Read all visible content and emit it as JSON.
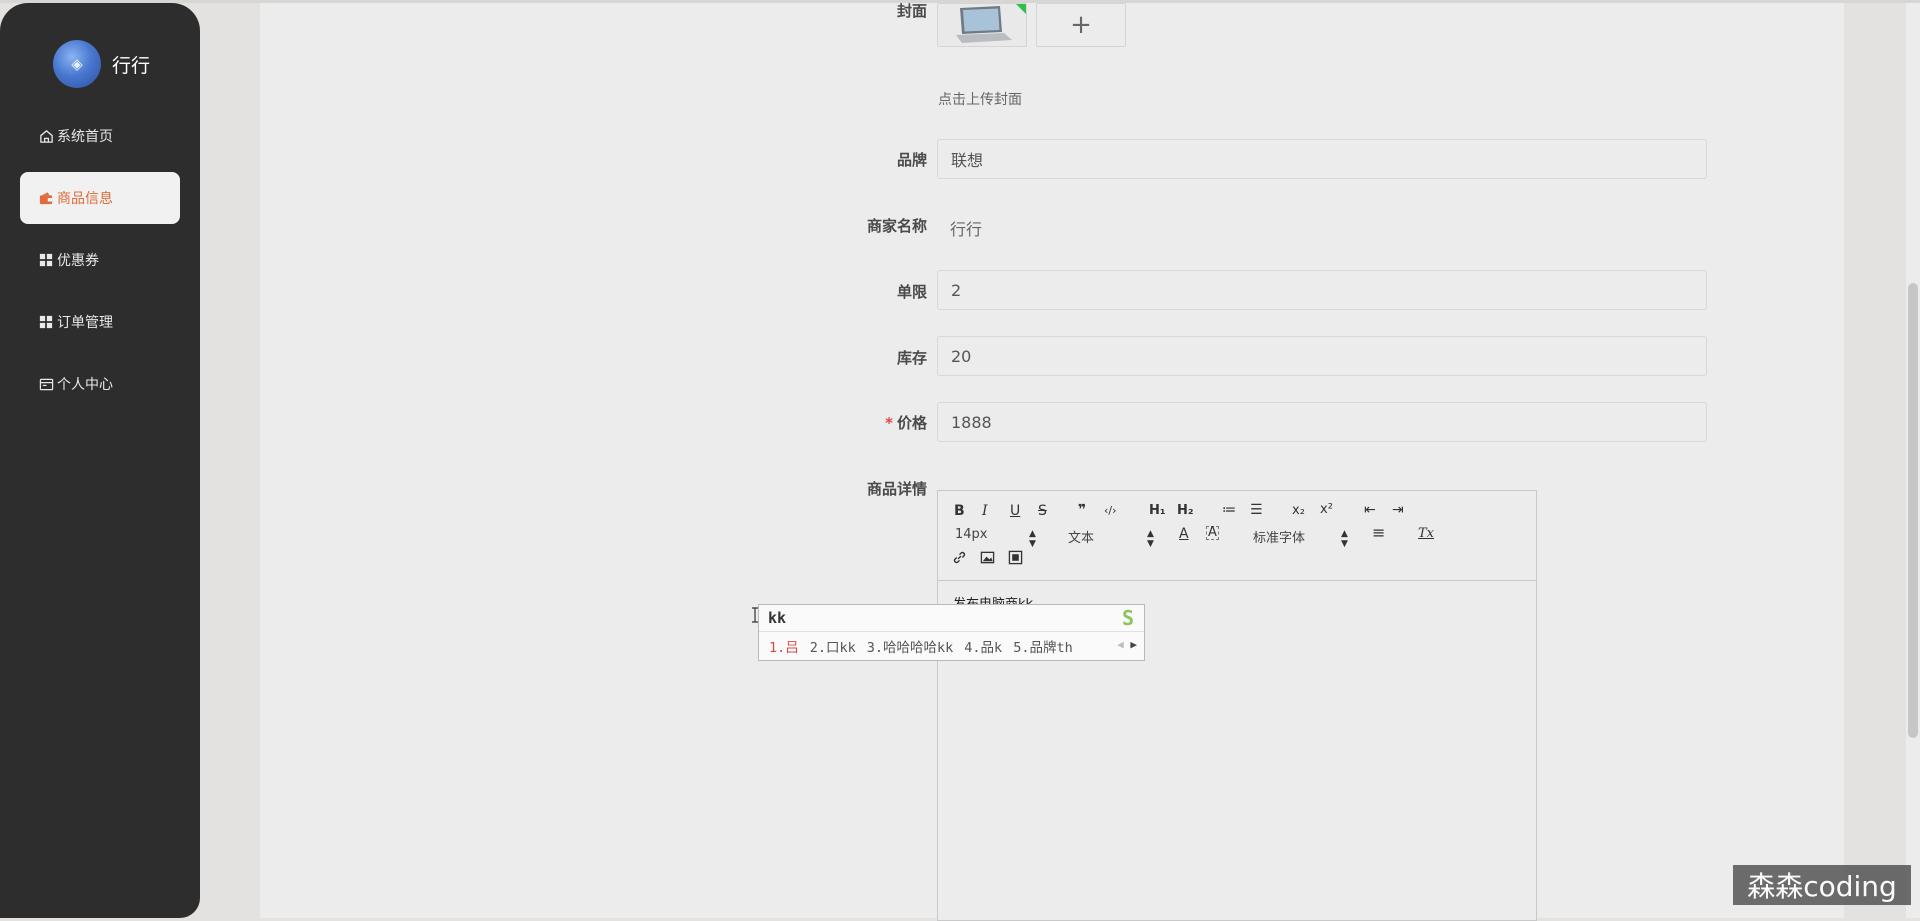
{
  "app": {
    "title": "行行",
    "logo_text": "◈"
  },
  "sidebar": {
    "items": [
      {
        "label": "系统首页",
        "icon": "home-icon"
      },
      {
        "label": "商品信息",
        "icon": "wallet-icon",
        "active": true
      },
      {
        "label": "优惠券",
        "icon": "grid-icon"
      },
      {
        "label": "订单管理",
        "icon": "grid-icon"
      },
      {
        "label": "个人中心",
        "icon": "card-icon"
      }
    ]
  },
  "form": {
    "cover": {
      "label": "封面",
      "add_symbol": "+",
      "hint": "点击上传封面"
    },
    "brand": {
      "label": "品牌",
      "value": "联想"
    },
    "merchant": {
      "label": "商家名称",
      "value": "行行"
    },
    "limit": {
      "label": "单限",
      "value": "2"
    },
    "stock": {
      "label": "库存",
      "value": "20"
    },
    "price": {
      "label": "价格",
      "required_mark": "*",
      "value": "1888"
    },
    "detail": {
      "label": "商品详情"
    }
  },
  "editor": {
    "toolbar": {
      "bold": "B",
      "italic": "I",
      "underline": "U",
      "strike": "S",
      "quote": "❞",
      "code": "‹/›",
      "h1": "H₁",
      "h2": "H₂",
      "ordered_list": "≔",
      "bullet_list": "☰",
      "subscript": "x₂",
      "superscript": "x²",
      "outdent": "⇤",
      "indent": "⇥",
      "font_size": "14px",
      "format": "文本",
      "font_color": "A",
      "background_color": "A",
      "font_family": "标准字体",
      "align": "≡",
      "clean": "Tx",
      "link": "🔗",
      "image": "▣",
      "video": "▤"
    },
    "content": "发布电脑商kk"
  },
  "ime": {
    "input": "kk",
    "candidates": [
      "1.吕",
      "2.口kk",
      "3.哈哈哈哈kk",
      "4.品k",
      "5.品牌th"
    ],
    "logo": "S"
  },
  "watermark": "森森coding"
}
